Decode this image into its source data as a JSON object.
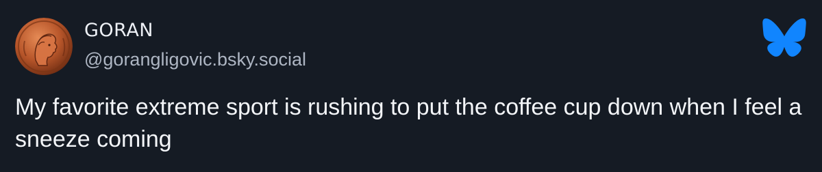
{
  "post": {
    "author": {
      "display_name": "GORAN",
      "handle": "@gorangligovic.bsky.social",
      "avatar_icon": "bronze-coin-portrait"
    },
    "platform_icon": "bluesky-butterfly-icon",
    "brand_color": "#1185fe",
    "text": "My favorite extreme sport is rushing to put the coffee cup down when I feel a sneeze coming"
  }
}
